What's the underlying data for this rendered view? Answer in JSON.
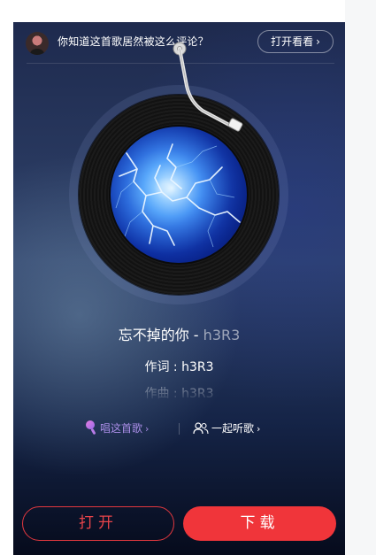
{
  "banner": {
    "text": "你知道这首歌居然被这么评论？",
    "button_label": "打开看看",
    "chevron": "›"
  },
  "player": {
    "song_title": "忘不掉的你",
    "separator": " - ",
    "artist": "h3R3",
    "lyrics": [
      "作词 : h3R3",
      "作曲 : h3R3"
    ],
    "cover_icon": "lightning-cover-image",
    "disc_icon": "vinyl-disc",
    "tonearm_icon": "tonearm"
  },
  "actions": {
    "sing_label": "唱这首歌",
    "listen_together_label": "一起听歌",
    "chevron": "›",
    "sing_icon": "microphone-icon",
    "listen_icon": "people-icon"
  },
  "footer": {
    "open_label": "打开",
    "download_label": "下载"
  },
  "colors": {
    "accent_red": "#f0353a",
    "sing_purple": "#a98de6",
    "background_top": "#1e2a4e",
    "background_bottom": "#060b1c"
  }
}
